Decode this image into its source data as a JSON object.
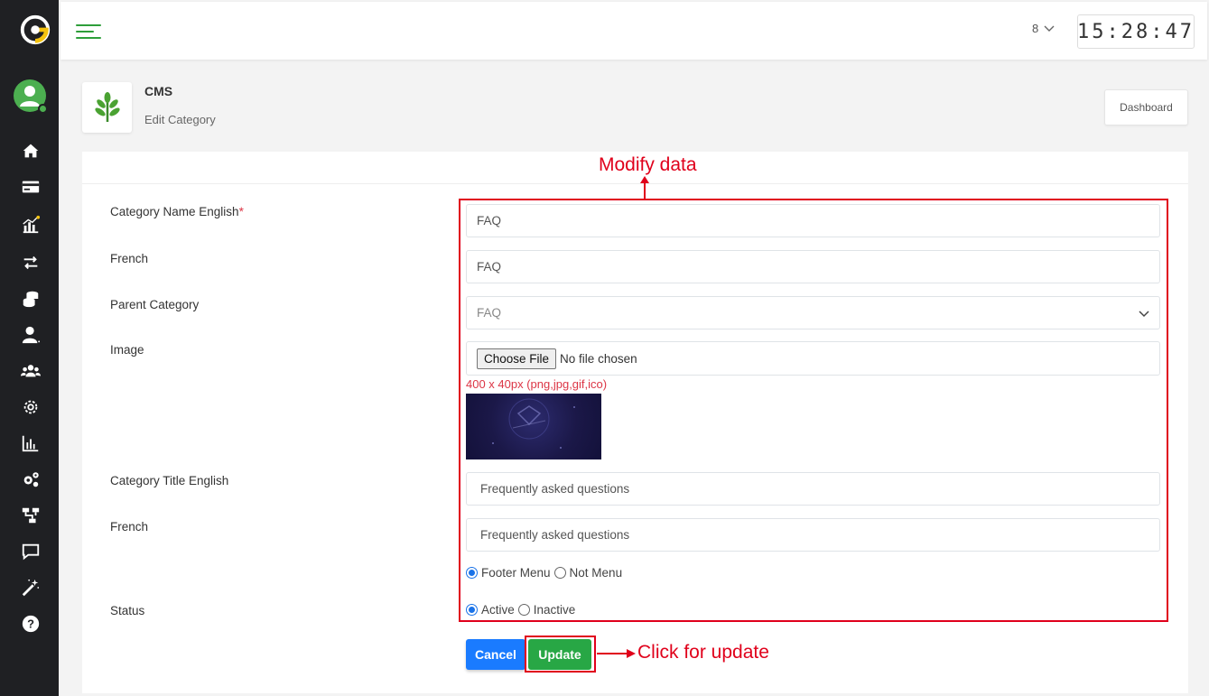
{
  "topbar": {
    "user_initial": "8",
    "clock": "15:28:47"
  },
  "header": {
    "title": "CMS",
    "subtitle": "Edit Category",
    "dashboard_button": "Dashboard"
  },
  "form": {
    "category_name_label": "Category Name English",
    "required_mark": "*",
    "category_name_value": "FAQ",
    "french_label": "French",
    "french_name_value": "FAQ",
    "parent_category_label": "Parent Category",
    "parent_category_value": "FAQ",
    "image_label": "Image",
    "choose_file_label": "Choose File",
    "no_file_text": "No file chosen",
    "image_hint": "400 x 40px (png,jpg,gif,ico)",
    "title_label": "Category Title English",
    "title_value": "Frequently asked questions",
    "french_title_label": "French",
    "french_title_value": "Frequently asked questions",
    "menu_options": [
      "Footer Menu",
      "Not Menu"
    ],
    "menu_selected": "Footer Menu",
    "status_label": "Status",
    "status_options": [
      "Active",
      "Inactive"
    ],
    "status_selected": "Active",
    "cancel_label": "Cancel",
    "update_label": "Update"
  },
  "annotations": {
    "modify": "Modify data",
    "update": "Click for update"
  },
  "colors": {
    "sidebar": "#1f2023",
    "accent_green": "#28a745",
    "primary_blue": "#1a7bff",
    "annotation_red": "#e0001b"
  }
}
